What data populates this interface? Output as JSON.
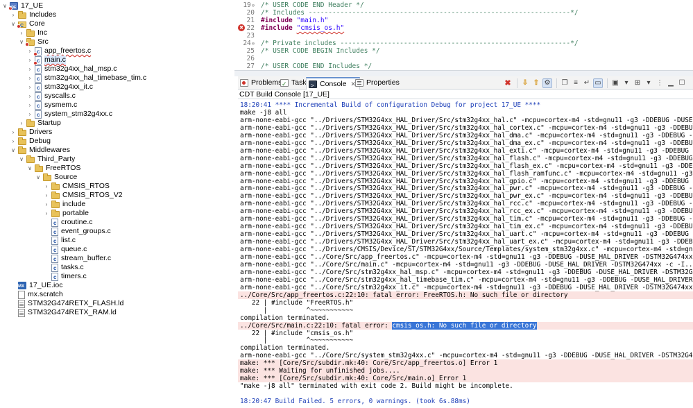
{
  "tree": {
    "items": [
      {
        "label": "17_UE",
        "level": 0,
        "icon": "project",
        "toggle": "open",
        "error": true
      },
      {
        "label": "Includes",
        "level": 1,
        "icon": "folder",
        "toggle": "closed",
        "error": false
      },
      {
        "label": "Core",
        "level": 1,
        "icon": "srcfolder",
        "toggle": "open",
        "error": true
      },
      {
        "label": "Inc",
        "level": 2,
        "icon": "folder",
        "toggle": "closed",
        "error": false
      },
      {
        "label": "Src",
        "level": 2,
        "icon": "folder",
        "toggle": "open",
        "error": true
      },
      {
        "label": "app_freertos.c",
        "level": 3,
        "icon": "file",
        "toggle": "closed",
        "error": true
      },
      {
        "label": "main.c",
        "level": 3,
        "icon": "file",
        "toggle": "closed",
        "error": true,
        "selected": true
      },
      {
        "label": "stm32g4xx_hal_msp.c",
        "level": 3,
        "icon": "file",
        "toggle": "closed",
        "error": false
      },
      {
        "label": "stm32g4xx_hal_timebase_tim.c",
        "level": 3,
        "icon": "file",
        "toggle": "closed",
        "error": false
      },
      {
        "label": "stm32g4xx_it.c",
        "level": 3,
        "icon": "file",
        "toggle": "closed",
        "error": false
      },
      {
        "label": "syscalls.c",
        "level": 3,
        "icon": "file",
        "toggle": "closed",
        "error": false
      },
      {
        "label": "sysmem.c",
        "level": 3,
        "icon": "file",
        "toggle": "closed",
        "error": false
      },
      {
        "label": "system_stm32g4xx.c",
        "level": 3,
        "icon": "file",
        "toggle": "closed",
        "error": false
      },
      {
        "label": "Startup",
        "level": 2,
        "icon": "folder",
        "toggle": "closed",
        "error": false
      },
      {
        "label": "Drivers",
        "level": 1,
        "icon": "folder",
        "toggle": "closed",
        "error": false
      },
      {
        "label": "Debug",
        "level": 1,
        "icon": "folder",
        "toggle": "closed",
        "error": false
      },
      {
        "label": "Middlewares",
        "level": 1,
        "icon": "folder",
        "toggle": "open",
        "error": false
      },
      {
        "label": "Third_Party",
        "level": 2,
        "icon": "folder",
        "toggle": "open",
        "error": false
      },
      {
        "label": "FreeRTOS",
        "level": 3,
        "icon": "folder",
        "toggle": "open",
        "error": false
      },
      {
        "label": "Source",
        "level": 4,
        "icon": "folder",
        "toggle": "open",
        "error": false
      },
      {
        "label": "CMSIS_RTOS",
        "level": 5,
        "icon": "folder",
        "toggle": "closed",
        "error": false
      },
      {
        "label": "CMSIS_RTOS_V2",
        "level": 5,
        "icon": "folder",
        "toggle": "closed",
        "error": false
      },
      {
        "label": "include",
        "level": 5,
        "icon": "folder",
        "toggle": "closed",
        "error": false
      },
      {
        "label": "portable",
        "level": 5,
        "icon": "folder",
        "toggle": "closed",
        "error": false
      },
      {
        "label": "croutine.c",
        "level": 5,
        "icon": "file",
        "toggle": "none",
        "error": false
      },
      {
        "label": "event_groups.c",
        "level": 5,
        "icon": "file",
        "toggle": "none",
        "error": false
      },
      {
        "label": "list.c",
        "level": 5,
        "icon": "file",
        "toggle": "none",
        "error": false
      },
      {
        "label": "queue.c",
        "level": 5,
        "icon": "file",
        "toggle": "none",
        "error": false
      },
      {
        "label": "stream_buffer.c",
        "level": 5,
        "icon": "file",
        "toggle": "none",
        "error": false
      },
      {
        "label": "tasks.c",
        "level": 5,
        "icon": "file",
        "toggle": "none",
        "error": false
      },
      {
        "label": "timers.c",
        "level": 5,
        "icon": "file",
        "toggle": "none",
        "error": false
      },
      {
        "label": "17_UE.ioc",
        "level": 1,
        "icon": "mx",
        "toggle": "none",
        "error": false
      },
      {
        "label": "mx.scratch",
        "level": 1,
        "icon": "scratch",
        "toggle": "none",
        "error": false
      },
      {
        "label": "STM32G474RETX_FLASH.ld",
        "level": 1,
        "icon": "ld",
        "toggle": "none",
        "error": false
      },
      {
        "label": "STM32G474RETX_RAM.ld",
        "level": 1,
        "icon": "ld",
        "toggle": "none",
        "error": false
      }
    ]
  },
  "editor": {
    "lines": [
      {
        "num": "19",
        "fold": true,
        "parts": [
          {
            "t": "/* USER CODE END Header */",
            "c": "cmt"
          }
        ]
      },
      {
        "num": "20",
        "fold": false,
        "parts": [
          {
            "t": "/* Includes ------------------------------------------------------------------*/",
            "c": "cmt"
          }
        ]
      },
      {
        "num": "21",
        "fold": false,
        "parts": [
          {
            "t": "#include",
            "c": "kw"
          },
          {
            "t": " ",
            "c": ""
          },
          {
            "t": "\"main.h\"",
            "c": "str"
          }
        ]
      },
      {
        "num": "22",
        "fold": false,
        "error": true,
        "parts": [
          {
            "t": "#include",
            "c": "kw"
          },
          {
            "t": " ",
            "c": ""
          },
          {
            "t": "\"cmsis_os.h\"",
            "c": "str squig"
          }
        ]
      },
      {
        "num": "23",
        "fold": false,
        "parts": []
      },
      {
        "num": "24",
        "fold": true,
        "parts": [
          {
            "t": "/* Private includes ----------------------------------------------------------*/",
            "c": "cmt"
          }
        ]
      },
      {
        "num": "25",
        "fold": false,
        "parts": [
          {
            "t": "/* USER CODE BEGIN Includes */",
            "c": "cmt"
          }
        ]
      },
      {
        "num": "26",
        "fold": false,
        "parts": []
      },
      {
        "num": "27",
        "fold": false,
        "parts": [
          {
            "t": "/* USER CODE END Includes */",
            "c": "cmt"
          }
        ]
      }
    ]
  },
  "tabs": [
    {
      "label": "Problems",
      "icon": "problems",
      "active": false
    },
    {
      "label": "Tasks",
      "icon": "tasks",
      "active": false
    },
    {
      "label": "Console",
      "icon": "console",
      "active": true,
      "close": "✕"
    },
    {
      "label": "Properties",
      "icon": "props",
      "active": false
    }
  ],
  "console": {
    "title": "CDT Build Console [17_UE]",
    "lines": [
      {
        "t": "18:20:41 **** Incremental Build of configuration Debug for project 17_UE ****",
        "k": "info"
      },
      {
        "t": "make -j8 all",
        "k": ""
      },
      {
        "t": "arm-none-eabi-gcc \"../Drivers/STM32G4xx_HAL_Driver/Src/stm32g4xx_hal.c\" -mcpu=cortex-m4 -std=gnu11 -g3 -DDEBUG -DUSE_HAL_DRIVER",
        "k": ""
      },
      {
        "t": "arm-none-eabi-gcc \"../Drivers/STM32G4xx_HAL_Driver/Src/stm32g4xx_hal_cortex.c\" -mcpu=cortex-m4 -std=gnu11 -g3 -DDEBUG -DUSE_HAL_DR",
        "k": ""
      },
      {
        "t": "arm-none-eabi-gcc \"../Drivers/STM32G4xx_HAL_Driver/Src/stm32g4xx_hal_dma.c\" -mcpu=cortex-m4 -std=gnu11 -g3 -DDEBUG -DUSE_HAL_DRIV",
        "k": ""
      },
      {
        "t": "arm-none-eabi-gcc \"../Drivers/STM32G4xx_HAL_Driver/Src/stm32g4xx_hal_dma_ex.c\" -mcpu=cortex-m4 -std=gnu11 -g3 -DDEBUG -DUSE_HAL_",
        "k": ""
      },
      {
        "t": "arm-none-eabi-gcc \"../Drivers/STM32G4xx_HAL_Driver/Src/stm32g4xx_hal_exti.c\" -mcpu=cortex-m4 -std=gnu11 -g3 -DDEBUG -DUSE_HAL_D",
        "k": ""
      },
      {
        "t": "arm-none-eabi-gcc \"../Drivers/STM32G4xx_HAL_Driver/Src/stm32g4xx_hal_flash.c\" -mcpu=cortex-m4 -std=gnu11 -g3 -DDEBUG -DUSE_HAL_",
        "k": ""
      },
      {
        "t": "arm-none-eabi-gcc \"../Drivers/STM32G4xx_HAL_Driver/Src/stm32g4xx_hal_flash_ex.c\" -mcpu=cortex-m4 -std=gnu11 -g3 -DDEBUG -DUSE_",
        "k": ""
      },
      {
        "t": "arm-none-eabi-gcc \"../Drivers/STM32G4xx_HAL_Driver/Src/stm32g4xx_hal_flash_ramfunc.c\" -mcpu=cortex-m4 -std=gnu11 -g3 -DDEBUG -D",
        "k": ""
      },
      {
        "t": "arm-none-eabi-gcc \"../Drivers/STM32G4xx_HAL_Driver/Src/stm32g4xx_hal_gpio.c\" -mcpu=cortex-m4 -std=gnu11 -g3 -DDEBUG -DUSE_HAL_D",
        "k": ""
      },
      {
        "t": "arm-none-eabi-gcc \"../Drivers/STM32G4xx_HAL_Driver/Src/stm32g4xx_hal_pwr.c\" -mcpu=cortex-m4 -std=gnu11 -g3 -DDEBUG -DUSE_HAL_DRIV",
        "k": ""
      },
      {
        "t": "arm-none-eabi-gcc \"../Drivers/STM32G4xx_HAL_Driver/Src/stm32g4xx_hal_pwr_ex.c\" -mcpu=cortex-m4 -std=gnu11 -g3 -DDEBUG -DUSE_HAL_",
        "k": ""
      },
      {
        "t": "arm-none-eabi-gcc \"../Drivers/STM32G4xx_HAL_Driver/Src/stm32g4xx_hal_rcc.c\" -mcpu=cortex-m4 -std=gnu11 -g3 -DDEBUG -DUSE_HAL_DRIV",
        "k": ""
      },
      {
        "t": "arm-none-eabi-gcc \"../Drivers/STM32G4xx_HAL_Driver/Src/stm32g4xx_hal_rcc_ex.c\" -mcpu=cortex-m4 -std=gnu11 -g3 -DDEBUG -DUSE_HAL_",
        "k": ""
      },
      {
        "t": "arm-none-eabi-gcc \"../Drivers/STM32G4xx_HAL_Driver/Src/stm32g4xx_hal_tim.c\" -mcpu=cortex-m4 -std=gnu11 -g3 -DDEBUG -DUSE_HAL_DRIV",
        "k": ""
      },
      {
        "t": "arm-none-eabi-gcc \"../Drivers/STM32G4xx_HAL_Driver/Src/stm32g4xx_hal_tim_ex.c\" -mcpu=cortex-m4 -std=gnu11 -g3 -DDEBUG -DUSE_HAL_",
        "k": ""
      },
      {
        "t": "arm-none-eabi-gcc \"../Drivers/STM32G4xx_HAL_Driver/Src/stm32g4xx_hal_uart.c\" -mcpu=cortex-m4 -std=gnu11 -g3 -DDEBUG -DUSE_HAL_DRI",
        "k": ""
      },
      {
        "t": "arm-none-eabi-gcc \"../Drivers/STM32G4xx_HAL_Driver/Src/stm32g4xx_hal_uart_ex.c\" -mcpu=cortex-m4 -std=gnu11 -g3 -DDEBUG -DUSE_HA",
        "k": ""
      },
      {
        "t": "arm-none-eabi-gcc \"../Drivers/CMSIS/Device/ST/STM32G4xx/Source/Templates/system_stm32g4xx.c\" -mcpu=cortex-m4 -std=gnu11 -g3 -D",
        "k": ""
      },
      {
        "t": "arm-none-eabi-gcc \"../Core/Src/app_freertos.c\" -mcpu=cortex-m4 -std=gnu11 -g3 -DDEBUG -DUSE_HAL_DRIVER -DSTM32G474xx -c -I../Co",
        "k": ""
      },
      {
        "t": "arm-none-eabi-gcc \"../Core/Src/main.c\" -mcpu=cortex-m4 -std=gnu11 -g3 -DDEBUG -DUSE_HAL_DRIVER -DSTM32G474xx -c -I../Core/Inc -",
        "k": ""
      },
      {
        "t": "arm-none-eabi-gcc \"../Core/Src/stm32g4xx_hal_msp.c\" -mcpu=cortex-m4 -std=gnu11 -g3 -DDEBUG -DUSE_HAL_DRIVER -DSTM32G474xx -c -",
        "k": ""
      },
      {
        "t": "arm-none-eabi-gcc \"../Core/Src/stm32g4xx_hal_timebase_tim.c\" -mcpu=cortex-m4 -std=gnu11 -g3 -DDEBUG -DUSE_HAL_DRIVER -DSTM32G47",
        "k": ""
      },
      {
        "t": "arm-none-eabi-gcc \"../Core/Src/stm32g4xx_it.c\" -mcpu=cortex-m4 -std=gnu11 -g3 -DDEBUG -DUSE_HAL_DRIVER -DSTM32G474xx -c -I../Co",
        "k": ""
      },
      {
        "t": "../Core/Src/app_freertos.c:22:10: fatal error: FreeRTOS.h: No such file or directory",
        "k": "errline"
      },
      {
        "t": "   22 | #include \"FreeRTOS.h\"",
        "k": ""
      },
      {
        "t": "      |          ^~~~~~~~~~~~",
        "k": ""
      },
      {
        "t": "compilation terminated.",
        "k": ""
      },
      {
        "t": "../Core/Src/main.c:22:10: fatal error: ",
        "k": "errline",
        "hl": "cmsis_os.h: No such file or directory"
      },
      {
        "t": "   22 | #include \"cmsis_os.h\"",
        "k": ""
      },
      {
        "t": "      |          ^~~~~~~~~~~~",
        "k": ""
      },
      {
        "t": "compilation terminated.",
        "k": ""
      },
      {
        "t": "arm-none-eabi-gcc \"../Core/Src/system_stm32g4xx.c\" -mcpu=cortex-m4 -std=gnu11 -g3 -DDEBUG -DUSE_HAL_DRIVER -DSTM32G474xx -c -I.",
        "k": ""
      },
      {
        "t": "make: *** [Core/Src/subdir.mk:40: Core/Src/app_freertos.o] Error 1",
        "k": "errline"
      },
      {
        "t": "make: *** Waiting for unfinished jobs....",
        "k": "errline"
      },
      {
        "t": "make: *** [Core/Src/subdir.mk:40: Core/Src/main.o] Error 1",
        "k": "errline"
      },
      {
        "t": "\"make -j8 all\" terminated with exit code 2. Build might be incomplete.",
        "k": ""
      },
      {
        "t": "",
        "k": ""
      },
      {
        "t": "18:20:47 Build Failed. 5 errors, 0 warnings. (took 6s.88ms)",
        "k": "info"
      }
    ]
  },
  "toolbar": {
    "icons": [
      "clear-console-icon",
      "scroll-lock-icon",
      "word-wrap-icon",
      "pin-console-icon",
      "display-console-icon",
      "open-console-icon",
      "view-menu-icon",
      "minimize-icon",
      "maximize-icon"
    ]
  },
  "colors": {
    "error_bg": "#fbe3e1",
    "info_text": "#1d3fb8",
    "selection": "#3875d7",
    "tree_selected": "#d9e8fb"
  }
}
